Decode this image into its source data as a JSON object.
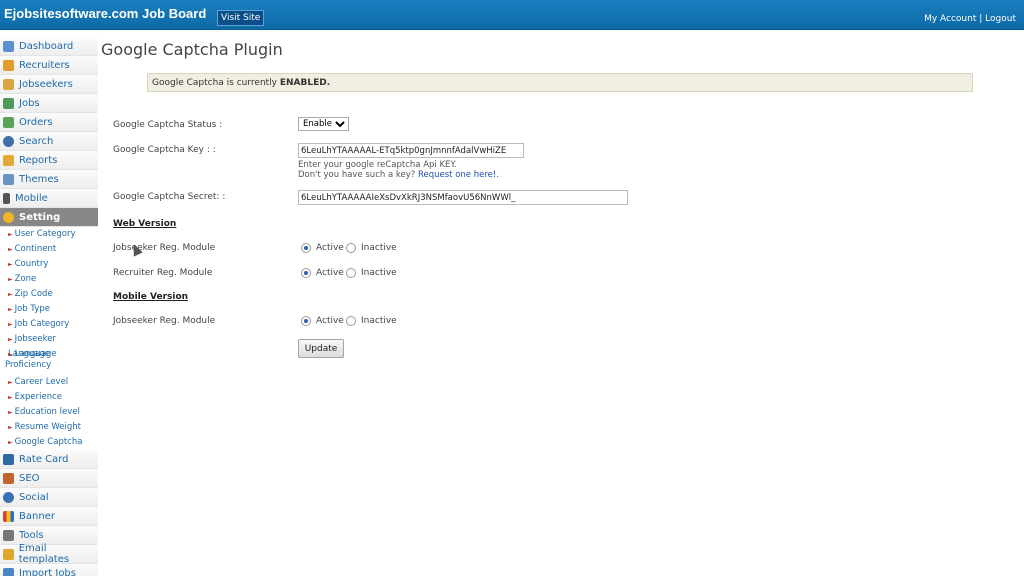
{
  "header": {
    "brand": "Ejobsitesoftware.com Job Board",
    "visit_site": "Visit Site",
    "my_account": "My Account",
    "separator": "|",
    "logout": "Logout"
  },
  "sidebar": {
    "top_items": [
      {
        "label": "Dashboard",
        "icon": "house-icon"
      },
      {
        "label": "Recruiters",
        "icon": "user-icon"
      },
      {
        "label": "Jobseekers",
        "icon": "users-icon"
      },
      {
        "label": "Jobs",
        "icon": "briefcase-icon"
      },
      {
        "label": "Orders",
        "icon": "orders-icon"
      },
      {
        "label": "Search",
        "icon": "search-icon"
      },
      {
        "label": "Reports",
        "icon": "book-icon"
      },
      {
        "label": "Themes",
        "icon": "grid-icon"
      },
      {
        "label": "Mobile",
        "icon": "mobile-icon"
      },
      {
        "label": "Setting",
        "icon": "gear-icon"
      }
    ],
    "sub_items": [
      "User Category",
      "Continent",
      "Country",
      "Zone",
      "Zip Code",
      "Job Type",
      "Job Category",
      "Jobseeker Language",
      "Language Proficiency",
      "Career Level",
      "Experience",
      "Education level",
      "Resume Weight",
      "Google Captcha"
    ],
    "bottom_items": [
      {
        "label": "Rate Card",
        "icon": "dollar-icon"
      },
      {
        "label": "SEO",
        "icon": "chart-icon"
      },
      {
        "label": "Social",
        "icon": "globe-icon"
      },
      {
        "label": "Banner",
        "icon": "banner-icon"
      },
      {
        "label": "Tools",
        "icon": "tools-icon"
      },
      {
        "label": "Email templates",
        "icon": "email-icon"
      },
      {
        "label": "Import Jobs",
        "icon": "download-icon"
      }
    ]
  },
  "page": {
    "title": "Google Captcha Plugin",
    "notice_prefix": "Google Captcha is currently ",
    "notice_status": "ENABLED."
  },
  "form": {
    "status_label": "Google Captcha Status :",
    "status_value": "Enabled",
    "key_label": "Google Captcha Key : :",
    "key_value": "6LeuLhYTAAAAAL-ETq5ktp0gnJmnnfAdalVwHiZE",
    "key_help_1": "Enter your google reCaptcha Api KEY.",
    "key_help_2_prefix": "Don't you have such a key? ",
    "key_help_link": "Request one here!",
    "key_help_suffix": ".",
    "secret_label": "Google Captcha Secret: :",
    "secret_value": "6LeuLhYTAAAAAIeXsDvXkRJ3NSMfaovU56NnWWl_",
    "web_version": "Web Version",
    "mobile_version": "Mobile Version",
    "web_jobseeker_label": "Jobseeker Reg. Module",
    "web_recruiter_label": "Recruiter Reg. Module",
    "mobile_jobseeker_label": "Jobseeker Reg. Module",
    "active": "Active",
    "inactive": "Inactive",
    "update": "Update"
  }
}
